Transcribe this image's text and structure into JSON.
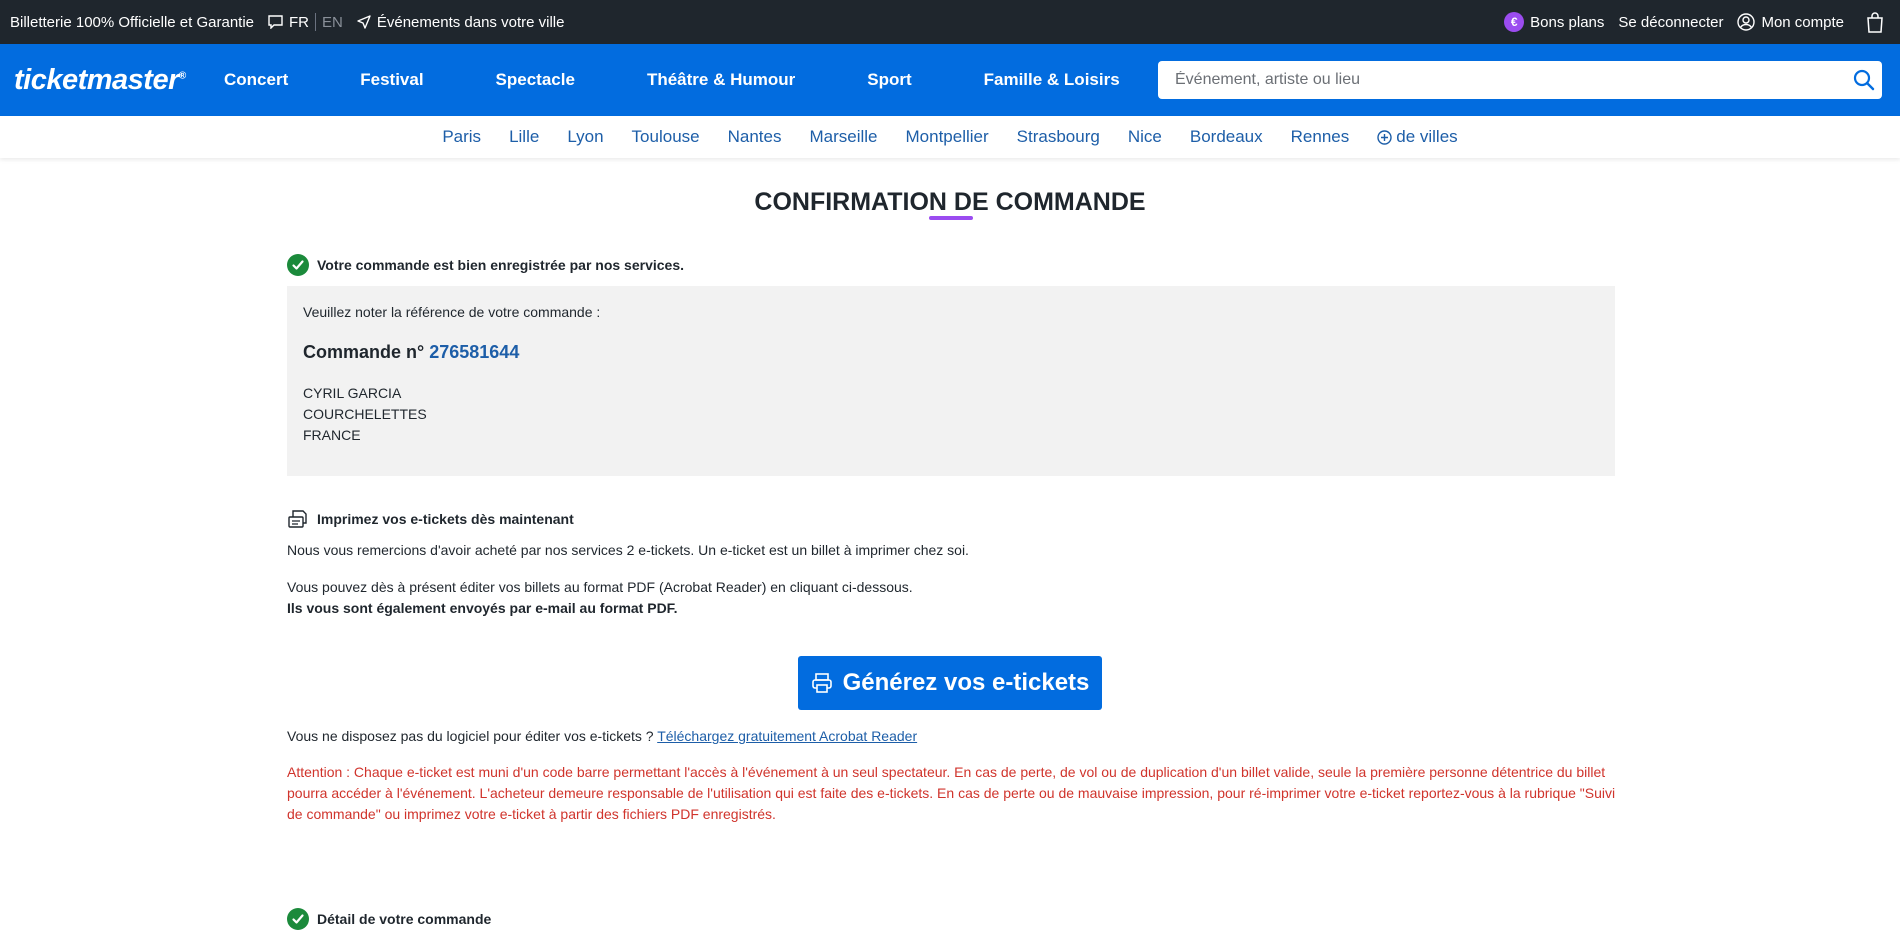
{
  "topbar": {
    "tagline": "Billetterie 100% Officielle et Garantie",
    "lang_fr": "FR",
    "lang_en": "EN",
    "events_city": "Événements dans votre ville",
    "deals_symbol": "€",
    "deals": "Bons plans",
    "logout": "Se déconnecter",
    "account": "Mon compte"
  },
  "nav": {
    "logo": "ticketmaster",
    "logo_mark": "®",
    "links": [
      "Concert",
      "Festival",
      "Spectacle",
      "Théâtre & Humour",
      "Sport",
      "Famille & Loisirs"
    ],
    "search_placeholder": "Événement, artiste ou lieu"
  },
  "cities": {
    "items": [
      "Paris",
      "Lille",
      "Lyon",
      "Toulouse",
      "Nantes",
      "Marseille",
      "Montpellier",
      "Strasbourg",
      "Nice",
      "Bordeaux",
      "Rennes"
    ],
    "more": "de villes"
  },
  "page": {
    "title": "CONFIRMATION DE COMMANDE",
    "registered": "Votre commande est bien enregistrée par nos services.",
    "ref_note": "Veuillez noter la référence de votre commande :",
    "order_label": "Commande n°",
    "order_number": "276581644",
    "address": [
      "CYRIL GARCIA",
      "COURCHELETTES",
      "FRANCE"
    ],
    "print_heading": "Imprimez vos e-tickets dès maintenant",
    "thanks": "Nous vous remercions d'avoir acheté par nos services 2 e-tickets. Un e-ticket est un billet à imprimer chez soi.",
    "pdf_info": "Vous pouvez dès à présent éditer vos billets au format PDF (Acrobat Reader) en cliquant ci-dessous.",
    "email_info": "Ils vous sont également envoyés par e-mail au format PDF.",
    "generate_button": "Générez vos e-tickets",
    "acrobat_question": "Vous ne disposez pas du logiciel pour éditer vos e-tickets ?",
    "acrobat_link": "Téléchargez gratuitement Acrobat Reader",
    "warning": "Attention : Chaque e-ticket est muni d'un code barre permettant l'accès à l'événement à un seul spectateur. En cas de perte, de vol ou de duplication d'un billet valide, seule la première personne détentrice du billet pourra accéder à l'événement. L'acheteur demeure responsable de l'utilisation qui est faite des e-tickets. En cas de perte ou de mauvaise impression, pour ré-imprimer votre e-ticket reportez-vous à la rubrique \"Suivi de commande\" ou imprimez votre e-ticket à partir des fichiers PDF enregistrés.",
    "order_detail": "Détail de votre commande"
  },
  "colors": {
    "topbar": "#1f262d",
    "brand_blue": "#026cdf",
    "link_blue": "#1d5ea8",
    "accent_purple": "#9b4cf0",
    "success_green": "#1b8a3b",
    "warning_red": "#d0342c"
  }
}
